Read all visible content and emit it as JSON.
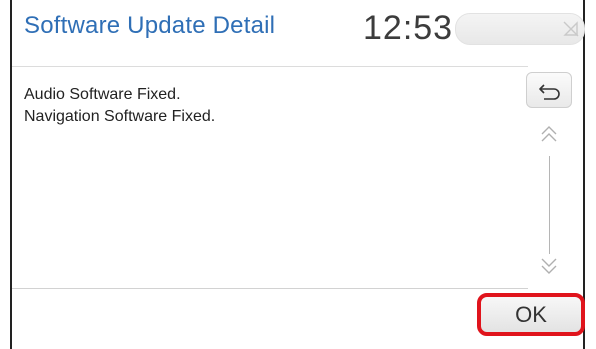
{
  "header": {
    "title": "Software Update Detail",
    "clock": "12:53"
  },
  "content": {
    "lines": [
      "Audio Software Fixed.",
      "Navigation Software Fixed."
    ]
  },
  "controls": {
    "back_icon": "return-arrow-icon",
    "scroll_up_icon": "double-chevron-up-icon",
    "scroll_down_icon": "double-chevron-down-icon",
    "ok_label": "OK"
  },
  "colors": {
    "title": "#2f6fb6",
    "highlight": "#e0141c"
  }
}
